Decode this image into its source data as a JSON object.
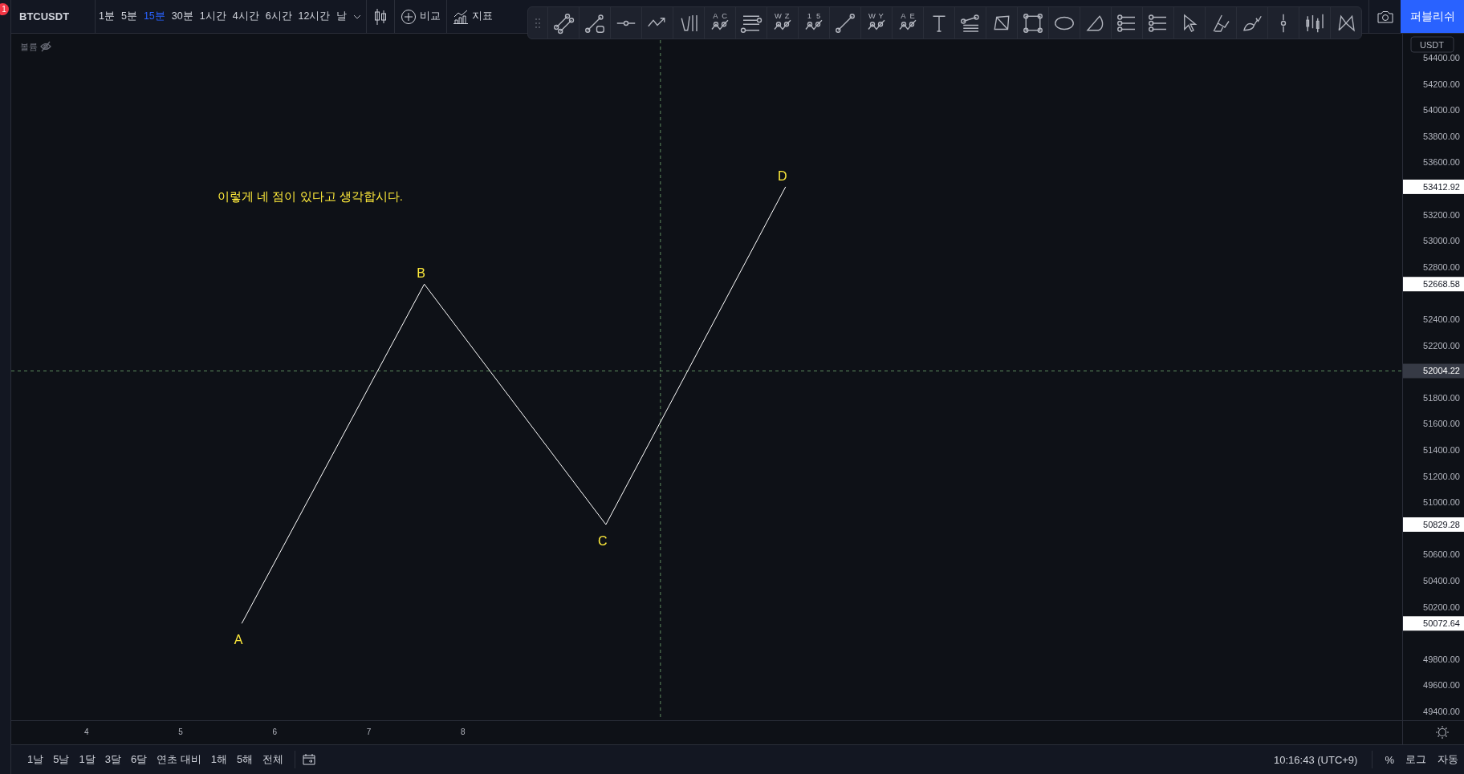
{
  "notification_badge": "1",
  "symbol": "BTCUSDT",
  "intervals": [
    {
      "label": "1분",
      "selected": false
    },
    {
      "label": "5분",
      "selected": false
    },
    {
      "label": "15분",
      "selected": true
    },
    {
      "label": "30분",
      "selected": false
    },
    {
      "label": "1시간",
      "selected": false
    },
    {
      "label": "4시간",
      "selected": false
    },
    {
      "label": "6시간",
      "selected": false
    },
    {
      "label": "12시간",
      "selected": false
    },
    {
      "label": "날",
      "selected": false
    }
  ],
  "compare_button": "비교",
  "indicators_button": "지표",
  "drawing_tools": [
    {
      "kind": "parallel"
    },
    {
      "kind": "line-box"
    },
    {
      "kind": "horizontal"
    },
    {
      "kind": "arrow-path"
    },
    {
      "kind": "fork"
    },
    {
      "kind": "zigzag",
      "letters": [
        "A",
        "C"
      ]
    },
    {
      "kind": "levels"
    },
    {
      "kind": "zigzag",
      "letters": [
        "W",
        "Z"
      ]
    },
    {
      "kind": "zigzag",
      "letters": [
        "1",
        "5"
      ]
    },
    {
      "kind": "line"
    },
    {
      "kind": "zigzag",
      "letters": [
        "W",
        "Y"
      ]
    },
    {
      "kind": "zigzag",
      "letters": [
        "A",
        "E"
      ]
    },
    {
      "kind": "text"
    },
    {
      "kind": "fan"
    },
    {
      "kind": "quad"
    },
    {
      "kind": "rect"
    },
    {
      "kind": "ellipse"
    },
    {
      "kind": "arc"
    },
    {
      "kind": "dotted-levels"
    },
    {
      "kind": "dotted-levels"
    },
    {
      "kind": "cursor"
    },
    {
      "kind": "highlighter"
    },
    {
      "kind": "brush"
    },
    {
      "kind": "vertical"
    },
    {
      "kind": "bars"
    },
    {
      "kind": "pattern"
    }
  ],
  "publish_button": "퍼블리쉬",
  "legend": {
    "label": "볼륨"
  },
  "currency": "USDT",
  "chart": {
    "note": {
      "text": "이렇게 네 점이 있다고 생각합시다."
    },
    "price_tags": [
      {
        "text": "53412.92"
      },
      {
        "text": "52668.58"
      },
      {
        "text": "50829.28"
      },
      {
        "text": "50072.64"
      }
    ],
    "chart_data": {
      "type": "line",
      "x": [
        5.65,
        7.59,
        9.52,
        11.43
      ],
      "series": [
        {
          "color": "#ffffff",
          "values": [
            50072.64,
            52668.58,
            50829.28,
            53412.92
          ]
        }
      ],
      "xlim": [
        3.2,
        18.64
      ],
      "ylim": [
        48921,
        54842
      ],
      "ref_lines": [
        {
          "axis": "x",
          "value": 10.1
        },
        {
          "axis": "y",
          "value": 52004.22,
          "label": "52004.22"
        }
      ],
      "xticks": [
        4,
        5,
        6,
        7,
        8
      ],
      "yticks": [
        {
          "value": 54400,
          "label": "54400.00"
        },
        {
          "value": 54200,
          "label": "54200.00"
        },
        {
          "value": 54000,
          "label": "54000.00"
        },
        {
          "value": 53800,
          "label": "53800.00"
        },
        {
          "value": 53600,
          "label": "53600.00"
        },
        {
          "value": 53200,
          "label": "53200.00"
        },
        {
          "value": 53000,
          "label": "53000.00"
        },
        {
          "value": 52800,
          "label": "52800.00"
        },
        {
          "value": 52400,
          "label": "52400.00"
        },
        {
          "value": 52200,
          "label": "52200.00"
        },
        {
          "value": 51800,
          "label": "51800.00"
        },
        {
          "value": 51600,
          "label": "51600.00"
        },
        {
          "value": 51400,
          "label": "51400.00"
        },
        {
          "value": 51200,
          "label": "51200.00"
        },
        {
          "value": 51000,
          "label": "51000.00"
        },
        {
          "value": 50600,
          "label": "50600.00"
        },
        {
          "value": 50400,
          "label": "50400.00"
        },
        {
          "value": 50200,
          "label": "50200.00"
        },
        {
          "value": 49800,
          "label": "49800.00"
        },
        {
          "value": 49600,
          "label": "49600.00"
        },
        {
          "value": 49400,
          "label": "49400.00"
        }
      ],
      "annotations": [
        {
          "text": "A",
          "x": 5.65,
          "y": 50072.64
        },
        {
          "text": "B",
          "x": 7.59,
          "y": 52668.58
        },
        {
          "text": "C",
          "x": 9.52,
          "y": 50829.28
        },
        {
          "text": "D",
          "x": 11.43,
          "y": 53412.92
        }
      ]
    }
  },
  "ranges": [
    "1날",
    "5날",
    "1달",
    "3달",
    "6달",
    "연초 대비",
    "1해",
    "5해",
    "전체"
  ],
  "clock": "10:16:43 (UTC+9)",
  "scale_options": [
    "%",
    "로그",
    "자동"
  ]
}
